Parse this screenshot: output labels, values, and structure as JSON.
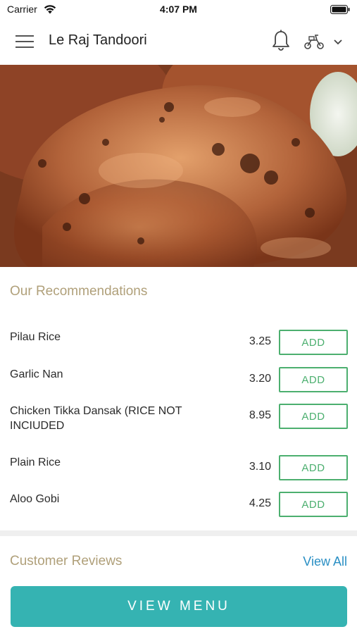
{
  "status_bar": {
    "carrier": "Carrier",
    "time": "4:07 PM"
  },
  "header": {
    "title": "Le Raj Tandoori",
    "icons": [
      "menu-icon",
      "bell-icon",
      "scooter-icon",
      "chevron-down-icon"
    ]
  },
  "hero": {
    "image": "tandoori-chicken-photo"
  },
  "recommendations": {
    "title": "Our Recommendations",
    "items": [
      {
        "name": "Pilau Rice",
        "price": "3.25",
        "button": "ADD"
      },
      {
        "name": "Garlic Nan",
        "price": "3.20",
        "button": "ADD"
      },
      {
        "name": "Chicken Tikka Dansak (RICE NOT INCIUDED",
        "price": "8.95",
        "button": "ADD"
      },
      {
        "name": "Plain Rice",
        "price": "3.10",
        "button": "ADD"
      },
      {
        "name": "Aloo Gobi",
        "price": "4.25",
        "button": "ADD"
      }
    ]
  },
  "reviews": {
    "title": "Customer Reviews",
    "view_all": "View All"
  },
  "view_menu_button": "VIEW MENU",
  "colors": {
    "accent_gold": "#b0a07a",
    "add_green": "#4caf6f",
    "link_blue": "#2a8fc4",
    "primary_teal": "#35b3b2"
  }
}
